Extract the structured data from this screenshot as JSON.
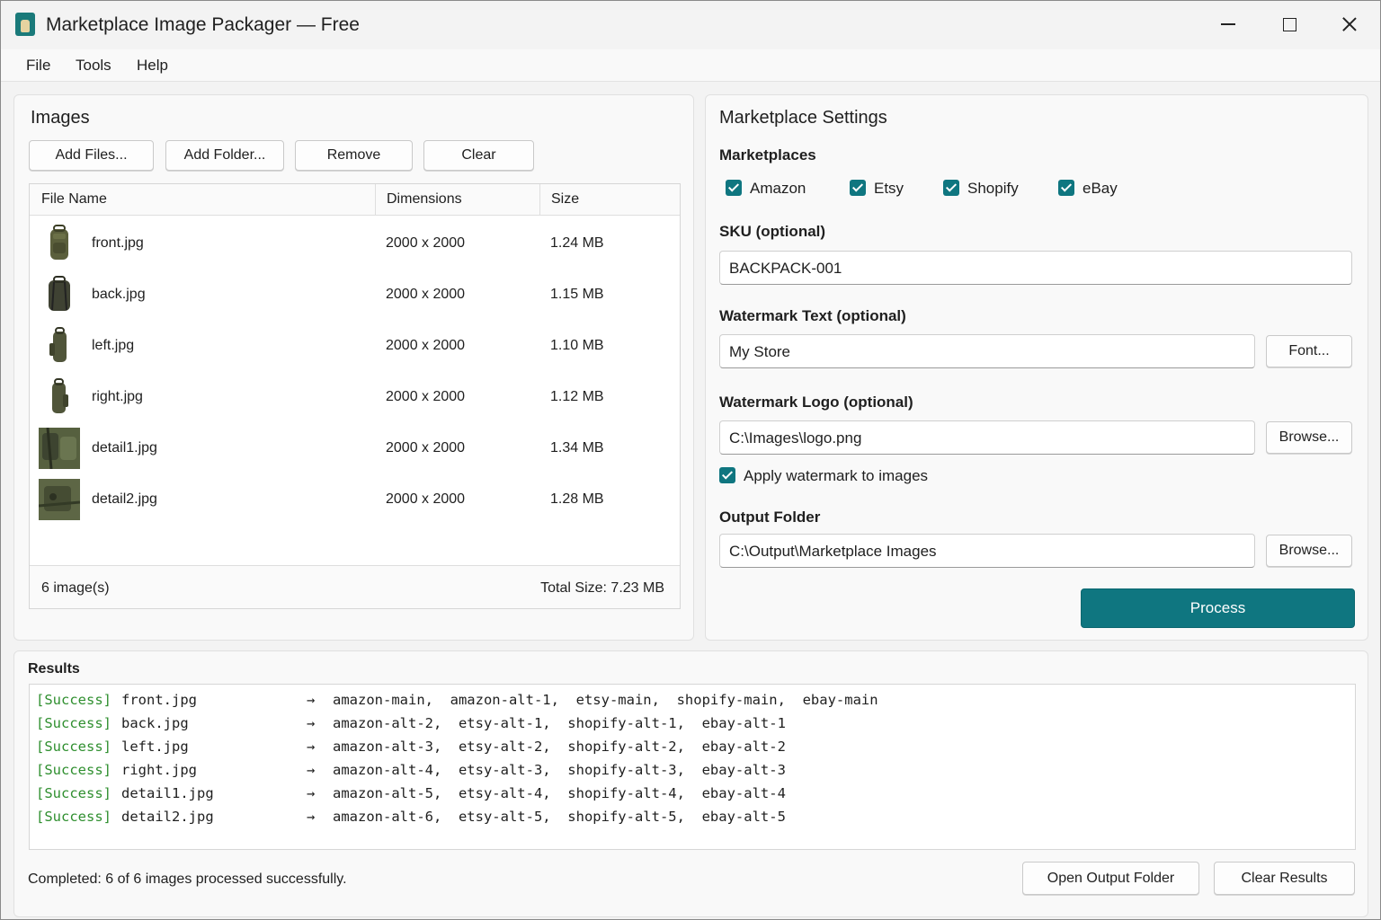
{
  "window": {
    "title": "Marketplace Image Packager — Free"
  },
  "menu": [
    "File",
    "Tools",
    "Help"
  ],
  "images_panel": {
    "title": "Images",
    "buttons": {
      "add_files": "Add Files...",
      "add_folder": "Add Folder...",
      "remove": "Remove",
      "clear": "Clear"
    },
    "columns": [
      "File Name",
      "Dimensions",
      "Size"
    ],
    "rows": [
      {
        "name": "front.jpg",
        "dimensions": "2000 x 2000",
        "size": "1.24 MB",
        "thumb": "backpack-front"
      },
      {
        "name": "back.jpg",
        "dimensions": "2000 x 2000",
        "size": "1.15 MB",
        "thumb": "backpack-back"
      },
      {
        "name": "left.jpg",
        "dimensions": "2000 x 2000",
        "size": "1.10 MB",
        "thumb": "backpack-left"
      },
      {
        "name": "right.jpg",
        "dimensions": "2000 x 2000",
        "size": "1.12 MB",
        "thumb": "backpack-right"
      },
      {
        "name": "detail1.jpg",
        "dimensions": "2000 x 2000",
        "size": "1.34 MB",
        "thumb": "backpack-detail"
      },
      {
        "name": "detail2.jpg",
        "dimensions": "2000 x 2000",
        "size": "1.28 MB",
        "thumb": "backpack-detail"
      }
    ],
    "footer": {
      "count": "6 image(s)",
      "total": "Total Size: 7.23 MB"
    }
  },
  "settings": {
    "title": "Marketplace Settings",
    "marketplaces_label": "Marketplaces",
    "marketplaces": [
      {
        "label": "Amazon",
        "checked": true
      },
      {
        "label": "Etsy",
        "checked": true
      },
      {
        "label": "Shopify",
        "checked": true
      },
      {
        "label": "eBay",
        "checked": true
      }
    ],
    "sku": {
      "label": "SKU (optional)",
      "value": "BACKPACK-001"
    },
    "watermark_text": {
      "label": "Watermark Text (optional)",
      "value": "My Store",
      "button": "Font..."
    },
    "watermark_logo": {
      "label": "Watermark Logo (optional)",
      "value": "C:\\Images\\logo.png",
      "button": "Browse..."
    },
    "apply_watermark": {
      "label": "Apply watermark to images",
      "checked": true
    },
    "output_folder": {
      "label": "Output Folder",
      "value": "C:\\Output\\Marketplace Images",
      "button": "Browse..."
    },
    "process_button": "Process"
  },
  "results": {
    "title": "Results",
    "arrow": "→",
    "lines": [
      {
        "status": "[Success]",
        "file": "front.jpg",
        "outputs": "amazon-main,  amazon-alt-1,  etsy-main,  shopify-main,  ebay-main"
      },
      {
        "status": "[Success]",
        "file": "back.jpg",
        "outputs": "amazon-alt-2,  etsy-alt-1,  shopify-alt-1,  ebay-alt-1"
      },
      {
        "status": "[Success]",
        "file": "left.jpg",
        "outputs": "amazon-alt-3,  etsy-alt-2,  shopify-alt-2,  ebay-alt-2"
      },
      {
        "status": "[Success]",
        "file": "right.jpg",
        "outputs": "amazon-alt-4,  etsy-alt-3,  shopify-alt-3,  ebay-alt-3"
      },
      {
        "status": "[Success]",
        "file": "detail1.jpg",
        "outputs": "amazon-alt-5,  etsy-alt-4,  shopify-alt-4,  ebay-alt-4"
      },
      {
        "status": "[Success]",
        "file": "detail2.jpg",
        "outputs": "amazon-alt-6,  etsy-alt-5,  shopify-alt-5,  ebay-alt-5"
      }
    ],
    "status_text": "Completed: 6 of 6 images processed successfully.",
    "buttons": {
      "open_output": "Open Output Folder",
      "clear_results": "Clear Results"
    }
  },
  "colors": {
    "accent": "#0f7680",
    "success": "#2f8f2f"
  }
}
